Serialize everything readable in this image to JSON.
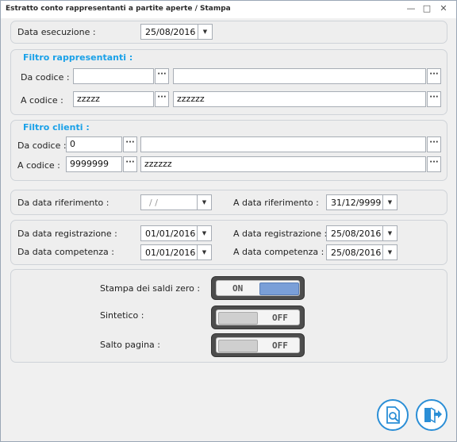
{
  "window": {
    "title": "Estratto conto rappresentanti a partite aperte / Stampa",
    "minimize": "—",
    "maximize": "□",
    "close": "✕"
  },
  "exec": {
    "label": "Data esecuzione :",
    "date": "25/08/2016"
  },
  "rappresentanti": {
    "title": "Filtro rappresentanti :",
    "from_label": "Da codice :",
    "from_code": "",
    "from_desc": "",
    "to_label": "A codice :",
    "to_code": "zzzzz",
    "to_desc": "zzzzzz"
  },
  "clienti": {
    "title": "Filtro clienti :",
    "from_label": "Da codice :",
    "from_code": "0",
    "from_desc": "",
    "to_label": "A codice :",
    "to_code": "9999999",
    "to_desc": "zzzzzz"
  },
  "riferimento": {
    "from_label": "Da data riferimento :",
    "from_date": "/ /",
    "to_label": "A data riferimento :",
    "to_date": "31/12/9999"
  },
  "registrazione": {
    "from_label": "Da data registrazione :",
    "from_date": "01/01/2016",
    "to_label": "A data registrazione :",
    "to_date": "25/08/2016"
  },
  "competenza": {
    "from_label": "Da data competenza :",
    "from_date": "01/01/2016",
    "to_label": "A data competenza :",
    "to_date": "25/08/2016"
  },
  "options": {
    "saldi_zero": {
      "label": "Stampa dei saldi zero :",
      "state": "ON"
    },
    "sintetico": {
      "label": "Sintetico :",
      "state": "OFF"
    },
    "salto_pagina": {
      "label": "Salto pagina :",
      "state": "OFF"
    }
  },
  "dots_glyph": "···",
  "arrow_glyph": "▼",
  "colors": {
    "accent": "#1aa1e8",
    "toggle_on": "#7a9fd8",
    "toggle_off": "#cfcfcf",
    "button_border": "#2a8ed6"
  },
  "icons": {
    "preview": "print-preview-icon",
    "exit": "exit-icon"
  }
}
